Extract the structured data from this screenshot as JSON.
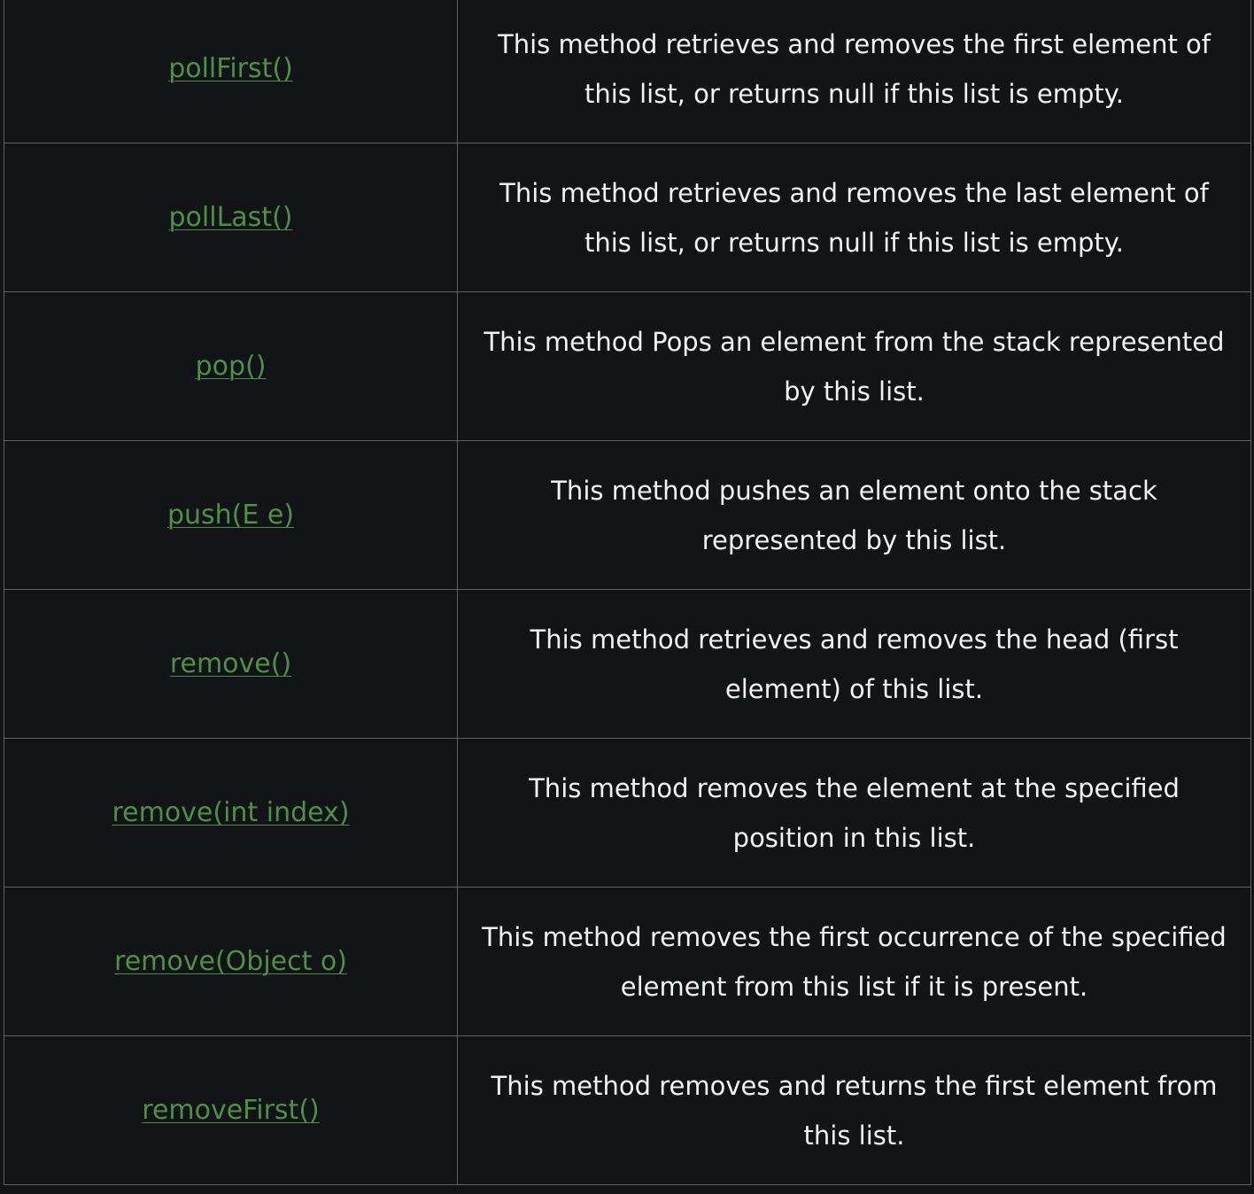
{
  "colors": {
    "background": "#131417",
    "border": "#5f6063",
    "link": "#4f8f4a",
    "text": "#f2f2f2"
  },
  "rows": [
    {
      "method": "pollFirst()",
      "description": "This method retrieves and removes the first element of this list, or returns null if this list is empty."
    },
    {
      "method": "pollLast()",
      "description": "This method retrieves and removes the last element of this list, or returns null if this list is empty."
    },
    {
      "method": "pop()",
      "description": "This method Pops an element from the stack represented by this list."
    },
    {
      "method": "push(E e)",
      "description": "This method pushes an element onto the stack represented by this list."
    },
    {
      "method": "remove()",
      "description": "This method retrieves and removes the head (first element) of this list."
    },
    {
      "method": "remove(int index)",
      "description": "This method removes the element at the specified position in this list."
    },
    {
      "method": "remove(Object o)",
      "description": "This method removes the first occurrence of the specified element from this list if it is present."
    },
    {
      "method": "removeFirst()",
      "description": "This method removes and returns the first element from this list."
    }
  ]
}
